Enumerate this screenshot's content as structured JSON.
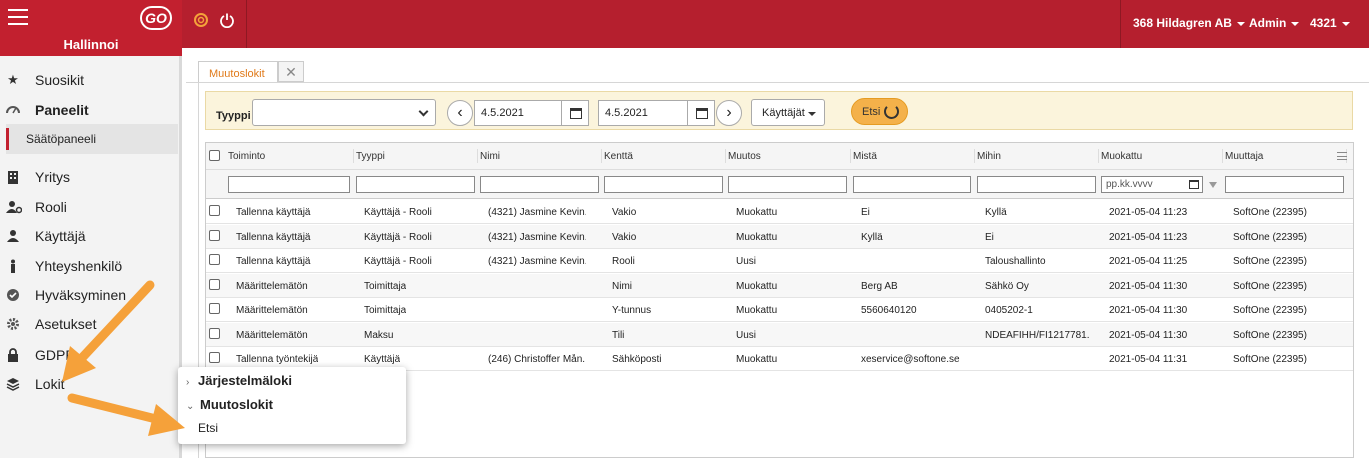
{
  "header": {
    "module_title": "Hallinnoi",
    "logo_text": "GO",
    "company_menu": "368 Hildagren AB",
    "role_menu": "Admin",
    "user_menu": "4321"
  },
  "sidebar": {
    "items": [
      {
        "label": "Suosikit",
        "icon": "star-icon"
      },
      {
        "label": "Paneelit",
        "icon": "dashboard-icon"
      },
      {
        "label": "Yritys",
        "icon": "building-icon"
      },
      {
        "label": "Rooli",
        "icon": "users-gear-icon"
      },
      {
        "label": "Käyttäjä",
        "icon": "user-icon"
      },
      {
        "label": "Yhteyshenkilö",
        "icon": "person-icon"
      },
      {
        "label": "Hyväksyminen",
        "icon": "check-circle-icon"
      },
      {
        "label": "Asetukset",
        "icon": "gear-icon"
      },
      {
        "label": "GDPR",
        "icon": "lock-icon"
      },
      {
        "label": "Lokit",
        "icon": "layers-icon"
      }
    ],
    "sub_item": "Säätöpaneeli"
  },
  "tabs": {
    "active": "Muutoslokit",
    "close": "✕"
  },
  "filter": {
    "type_label": "Tyyppi",
    "type_value": "",
    "date_from": "4.5.2021",
    "date_to": "4.5.2021",
    "users_dropdown": "Käyttäjät",
    "search_button": "Etsi"
  },
  "grid": {
    "columns": [
      "Toiminto",
      "Tyyppi",
      "Nimi",
      "Kenttä",
      "Muutos",
      "Mistä",
      "Mihin",
      "Muokattu",
      "Muuttaja"
    ],
    "date_placeholder": "pp.kk.vvvv",
    "rows": [
      [
        "Tallenna käyttäjä",
        "Käyttäjä - Rooli",
        "(4321) Jasmine Kevin...",
        "Vakio",
        "Muokattu",
        "Ei",
        "Kyllä",
        "2021-05-04 11:23",
        "SoftOne (22395)"
      ],
      [
        "Tallenna käyttäjä",
        "Käyttäjä - Rooli",
        "(4321) Jasmine Kevin...",
        "Vakio",
        "Muokattu",
        "Kyllä",
        "Ei",
        "2021-05-04 11:23",
        "SoftOne (22395)"
      ],
      [
        "Tallenna käyttäjä",
        "Käyttäjä - Rooli",
        "(4321) Jasmine Kevin...",
        "Rooli",
        "Uusi",
        "",
        "Taloushallinto",
        "2021-05-04 11:25",
        "SoftOne (22395)"
      ],
      [
        "Määrittelemätön",
        "Toimittaja",
        "",
        "Nimi",
        "Muokattu",
        "Berg AB",
        "Sähkö Oy",
        "2021-05-04 11:30",
        "SoftOne (22395)"
      ],
      [
        "Määrittelemätön",
        "Toimittaja",
        "",
        "Y-tunnus",
        "Muokattu",
        "5560640120",
        "0405202-1",
        "2021-05-04 11:30",
        "SoftOne (22395)"
      ],
      [
        "Määrittelemätön",
        "Maksu",
        "",
        "Tili",
        "Uusi",
        "",
        "NDEAFIHH/FI1217781...",
        "2021-05-04 11:30",
        "SoftOne (22395)"
      ],
      [
        "Tallenna työntekijä",
        "Käyttäjä",
        "(246) Christoffer Mån...",
        "Sähköposti",
        "Muokattu",
        "xeservice@softone.se",
        "",
        "2021-05-04 11:31",
        "SoftOne (22395)"
      ]
    ]
  },
  "flyout": {
    "items": [
      {
        "label": "Järjestelmäloki",
        "expanded": false
      },
      {
        "label": "Muutoslokit",
        "expanded": true
      },
      {
        "label": "Etsi"
      }
    ]
  },
  "colors": {
    "brand_red": "#b51f2e",
    "accent_orange": "#f4a23a",
    "filter_bg": "#fbf4dc"
  }
}
